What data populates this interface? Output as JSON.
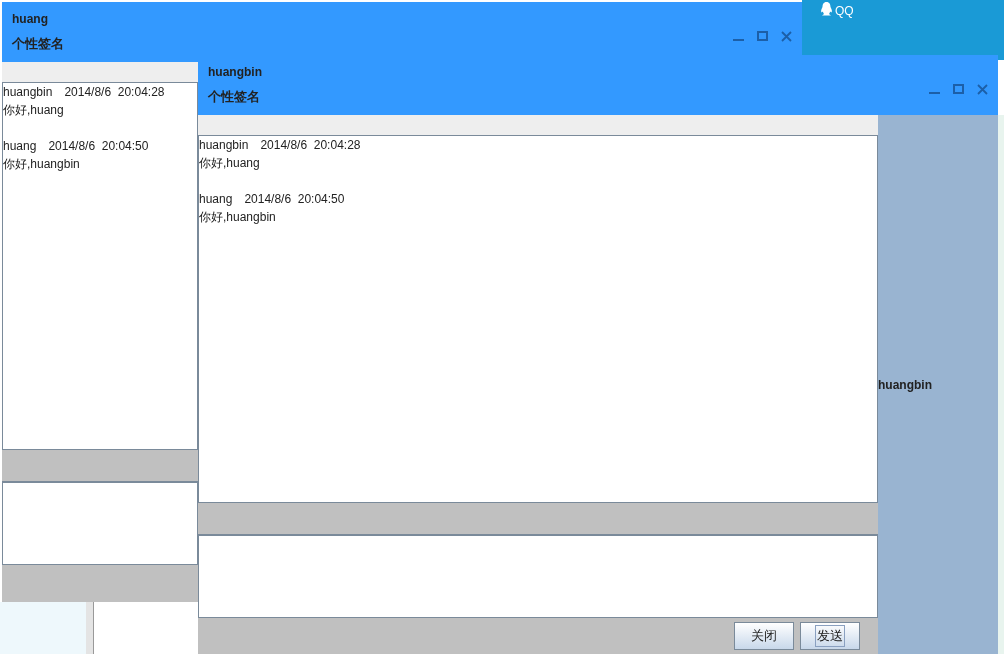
{
  "tray_panel": {
    "label": "QQ"
  },
  "windows": [
    {
      "title": "huang",
      "signature": "个性签名",
      "messages": [
        {
          "sender": "huangbin",
          "time": "2014/8/6  20:04:28",
          "text": "你好,huang"
        },
        {
          "sender": "huang",
          "time": "2014/8/6  20:04:50",
          "text": "你好,huangbin"
        }
      ]
    },
    {
      "title": "huangbin",
      "signature": "个性签名",
      "messages": [
        {
          "sender": "huangbin",
          "time": "2014/8/6  20:04:28",
          "text": "你好,huang"
        },
        {
          "sender": "huang",
          "time": "2014/8/6  20:04:50",
          "text": "你好,huangbin"
        }
      ],
      "friend_name": "huangbin",
      "buttons": [
        {
          "label": "关闭",
          "focused": false
        },
        {
          "label": "发送",
          "focused": true
        }
      ]
    }
  ]
}
